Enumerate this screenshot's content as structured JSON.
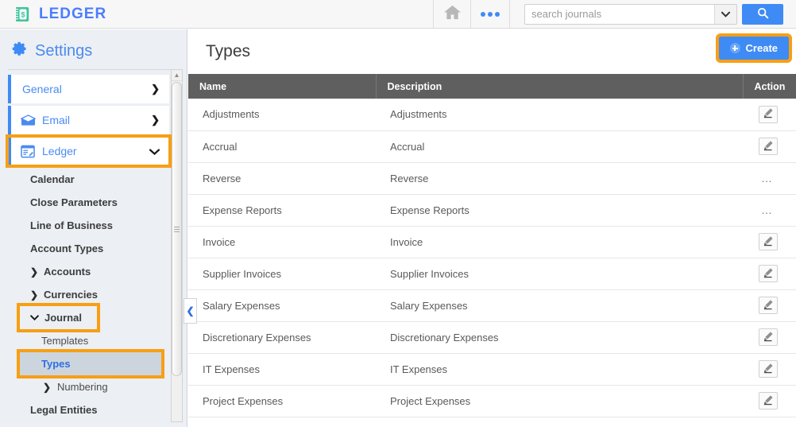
{
  "topbar": {
    "brand": "LEDGER",
    "brand_icon": "ledger-book-dollar-icon",
    "home_icon": "home-icon",
    "more_icon": "more-dots-icon",
    "search_placeholder": "search journals",
    "search_value": "",
    "search_caret_icon": "chevron-down-icon",
    "search_button_icon": "search-icon",
    "accent_blue": "#3e8bf5",
    "brand_green": "#3fc39a"
  },
  "sidebar": {
    "title": "Settings",
    "gear_icon": "gear-icon",
    "cards": [
      {
        "label": "General",
        "icon": null,
        "chevron": "❯",
        "highlighted": false
      },
      {
        "label": "Email",
        "icon": "envelope-icon",
        "chevron": "❯",
        "highlighted": false
      },
      {
        "label": "Ledger",
        "icon": "ledger-icon",
        "chevron": "❯",
        "highlighted": true
      }
    ],
    "items": [
      {
        "label": "Calendar",
        "arrow": null,
        "style": "bold",
        "boxed": false
      },
      {
        "label": "Close Parameters",
        "arrow": null,
        "style": "bold",
        "boxed": false
      },
      {
        "label": "Line of Business",
        "arrow": null,
        "style": "bold",
        "boxed": false
      },
      {
        "label": "Account Types",
        "arrow": null,
        "style": "bold",
        "boxed": false
      },
      {
        "label": "Accounts",
        "arrow": "❯",
        "style": "bold",
        "boxed": false
      },
      {
        "label": "Currencies",
        "arrow": "❯",
        "style": "bold",
        "boxed": false
      },
      {
        "label": "Journal",
        "arrow": "❯",
        "style": "bold",
        "boxed": true
      },
      {
        "label": "Templates",
        "arrow": null,
        "style": "plain",
        "boxed": false
      },
      {
        "label": "Types",
        "arrow": null,
        "style": "selected",
        "boxed": true
      },
      {
        "label": "Numbering",
        "arrow": "❯",
        "style": "plain",
        "boxed": false
      },
      {
        "label": "Legal Entities",
        "arrow": null,
        "style": "bold",
        "boxed": false
      }
    ],
    "scrollbar": {
      "up_icon": "scroll-up-arrow-icon",
      "grip_icon": "scrollbar-grip-icon"
    },
    "collapse_icon": "❮",
    "highlight_color": "#f79f14",
    "selected_bg": "#ccd5de"
  },
  "main": {
    "page_title": "Types",
    "create_label": "Create",
    "create_icon": "plus-circle-icon",
    "columns": [
      "Name",
      "Description",
      "Action"
    ],
    "rows": [
      {
        "name": "Adjustments",
        "description": "Adjustments",
        "action": "edit"
      },
      {
        "name": "Accrual",
        "description": "Accrual",
        "action": "edit"
      },
      {
        "name": "Reverse",
        "description": "Reverse",
        "action": "ellipsis"
      },
      {
        "name": "Expense Reports",
        "description": "Expense Reports",
        "action": "ellipsis"
      },
      {
        "name": "Invoice",
        "description": "Invoice",
        "action": "edit"
      },
      {
        "name": "Supplier Invoices",
        "description": "Supplier Invoices",
        "action": "edit"
      },
      {
        "name": "Salary Expenses",
        "description": "Salary Expenses",
        "action": "edit"
      },
      {
        "name": "Discretionary Expenses",
        "description": "Discretionary Expenses",
        "action": "edit"
      },
      {
        "name": "IT Expenses",
        "description": "IT Expenses",
        "action": "edit"
      },
      {
        "name": "Project Expenses",
        "description": "Project Expenses",
        "action": "edit"
      }
    ],
    "edit_icon": "pencil-edit-icon",
    "ellipsis_icon": "ellipsis-icon",
    "ellipsis_glyph": "…",
    "header_bg": "#5f5f5f"
  }
}
